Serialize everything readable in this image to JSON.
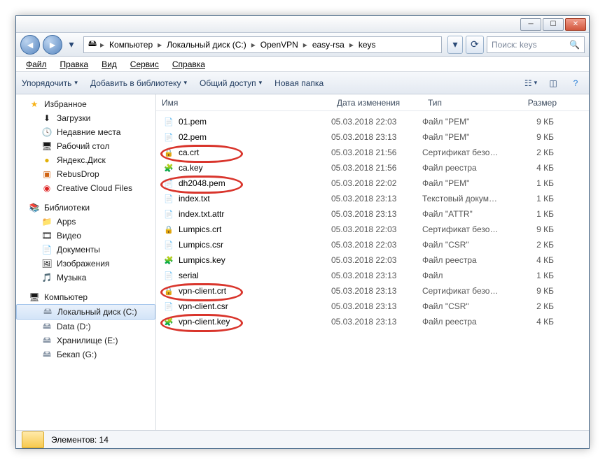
{
  "titlebar": {
    "min": "─",
    "max": "☐",
    "close": "✕"
  },
  "nav": {
    "back": "◄",
    "fwd": "►",
    "drop": "▾",
    "refresh": "⟳",
    "search_prefix": "Поиск:",
    "search_term": "keys"
  },
  "breadcrumb": [
    "Компьютер",
    "Локальный диск (C:)",
    "OpenVPN",
    "easy-rsa",
    "keys"
  ],
  "menu": {
    "file": "Файл",
    "edit": "Правка",
    "view": "Вид",
    "tools": "Сервис",
    "help": "Справка"
  },
  "toolbar": {
    "organize": "Упорядочить",
    "add_lib": "Добавить в библиотеку",
    "share": "Общий доступ",
    "new_folder": "Новая папка",
    "caret": "▾"
  },
  "sidebar": {
    "favorites": "Избранное",
    "fav_items": [
      "Загрузки",
      "Недавние места",
      "Рабочий стол",
      "Яндекс.Диск",
      "RebusDrop",
      "Creative Cloud Files"
    ],
    "libraries": "Библиотеки",
    "lib_items": [
      "Apps",
      "Видео",
      "Документы",
      "Изображения",
      "Музыка"
    ],
    "computer": "Компьютер",
    "drives": [
      "Локальный диск (C:)",
      "Data (D:)",
      "Хранилище (E:)",
      "Бекап (G:)"
    ]
  },
  "columns": {
    "name": "Имя",
    "date": "Дата изменения",
    "type": "Тип",
    "size": "Размер"
  },
  "files": [
    {
      "name": "01.pem",
      "date": "05.03.2018 22:03",
      "type": "Файл \"PEM\"",
      "size": "9 КБ",
      "icon": "📄",
      "hl": false
    },
    {
      "name": "02.pem",
      "date": "05.03.2018 23:13",
      "type": "Файл \"PEM\"",
      "size": "9 КБ",
      "icon": "📄",
      "hl": false
    },
    {
      "name": "ca.crt",
      "date": "05.03.2018 21:56",
      "type": "Сертификат безо…",
      "size": "2 КБ",
      "icon": "🔒",
      "hl": true
    },
    {
      "name": "ca.key",
      "date": "05.03.2018 21:56",
      "type": "Файл реестра",
      "size": "4 КБ",
      "icon": "🧩",
      "hl": false
    },
    {
      "name": "dh2048.pem",
      "date": "05.03.2018 22:02",
      "type": "Файл \"PEM\"",
      "size": "1 КБ",
      "icon": "📄",
      "hl": true
    },
    {
      "name": "index.txt",
      "date": "05.03.2018 23:13",
      "type": "Текстовый докум…",
      "size": "1 КБ",
      "icon": "📄",
      "hl": false
    },
    {
      "name": "index.txt.attr",
      "date": "05.03.2018 23:13",
      "type": "Файл \"ATTR\"",
      "size": "1 КБ",
      "icon": "📄",
      "hl": false
    },
    {
      "name": "Lumpics.crt",
      "date": "05.03.2018 22:03",
      "type": "Сертификат безо…",
      "size": "9 КБ",
      "icon": "🔒",
      "hl": false
    },
    {
      "name": "Lumpics.csr",
      "date": "05.03.2018 22:03",
      "type": "Файл \"CSR\"",
      "size": "2 КБ",
      "icon": "📄",
      "hl": false
    },
    {
      "name": "Lumpics.key",
      "date": "05.03.2018 22:03",
      "type": "Файл реестра",
      "size": "4 КБ",
      "icon": "🧩",
      "hl": false
    },
    {
      "name": "serial",
      "date": "05.03.2018 23:13",
      "type": "Файл",
      "size": "1 КБ",
      "icon": "📄",
      "hl": false
    },
    {
      "name": "vpn-client.crt",
      "date": "05.03.2018 23:13",
      "type": "Сертификат безо…",
      "size": "9 КБ",
      "icon": "🔒",
      "hl": true
    },
    {
      "name": "vpn-client.csr",
      "date": "05.03.2018 23:13",
      "type": "Файл \"CSR\"",
      "size": "2 КБ",
      "icon": "📄",
      "hl": false
    },
    {
      "name": "vpn-client.key",
      "date": "05.03.2018 23:13",
      "type": "Файл реестра",
      "size": "4 КБ",
      "icon": "🧩",
      "hl": true
    }
  ],
  "status": {
    "prefix": "Элементов:",
    "count": "14"
  }
}
